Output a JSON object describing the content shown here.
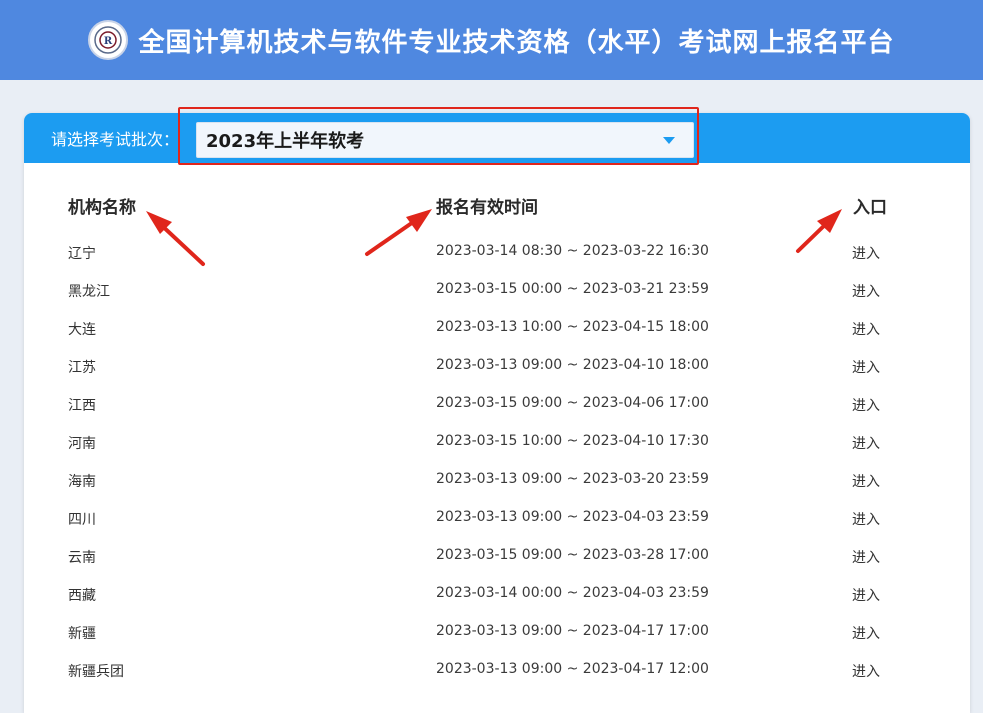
{
  "header": {
    "title": "全国计算机技术与软件专业技术资格（水平）考试网上报名平台"
  },
  "selector": {
    "label": "请选择考试批次：",
    "value": "2023年上半年软考"
  },
  "table": {
    "columns": [
      "机构名称",
      "报名有效时间",
      "入口"
    ],
    "rows": [
      {
        "name": "辽宁",
        "time": "2023-03-14 08:30 ~ 2023-03-22 16:30",
        "link": "进入"
      },
      {
        "name": "黑龙江",
        "time": "2023-03-15 00:00 ~ 2023-03-21 23:59",
        "link": "进入"
      },
      {
        "name": "大连",
        "time": "2023-03-13 10:00 ~ 2023-04-15 18:00",
        "link": "进入"
      },
      {
        "name": "江苏",
        "time": "2023-03-13 09:00 ~ 2023-04-10 18:00",
        "link": "进入"
      },
      {
        "name": "江西",
        "time": "2023-03-15 09:00 ~ 2023-04-06 17:00",
        "link": "进入"
      },
      {
        "name": "河南",
        "time": "2023-03-15 10:00 ~ 2023-04-10 17:30",
        "link": "进入"
      },
      {
        "name": "海南",
        "time": "2023-03-13 09:00 ~ 2023-03-20 23:59",
        "link": "进入"
      },
      {
        "name": "四川",
        "time": "2023-03-13 09:00 ~ 2023-04-03 23:59",
        "link": "进入"
      },
      {
        "name": "云南",
        "time": "2023-03-15 09:00 ~ 2023-03-28 17:00",
        "link": "进入"
      },
      {
        "name": "西藏",
        "time": "2023-03-14 00:00 ~ 2023-04-03 23:59",
        "link": "进入"
      },
      {
        "name": "新疆",
        "time": "2023-03-13 09:00 ~ 2023-04-17 17:00",
        "link": "进入"
      },
      {
        "name": "新疆兵团",
        "time": "2023-03-13 09:00 ~ 2023-04-17 12:00",
        "link": "进入"
      }
    ]
  },
  "colors": {
    "header_bg": "#4f88e0",
    "bar_bg": "#1c9cf1",
    "annotation_red": "#e0261b"
  },
  "icons": {
    "logo": "exam-seal-icon",
    "dropdown": "chevron-down-icon",
    "annotation": "red-arrow-icon"
  }
}
